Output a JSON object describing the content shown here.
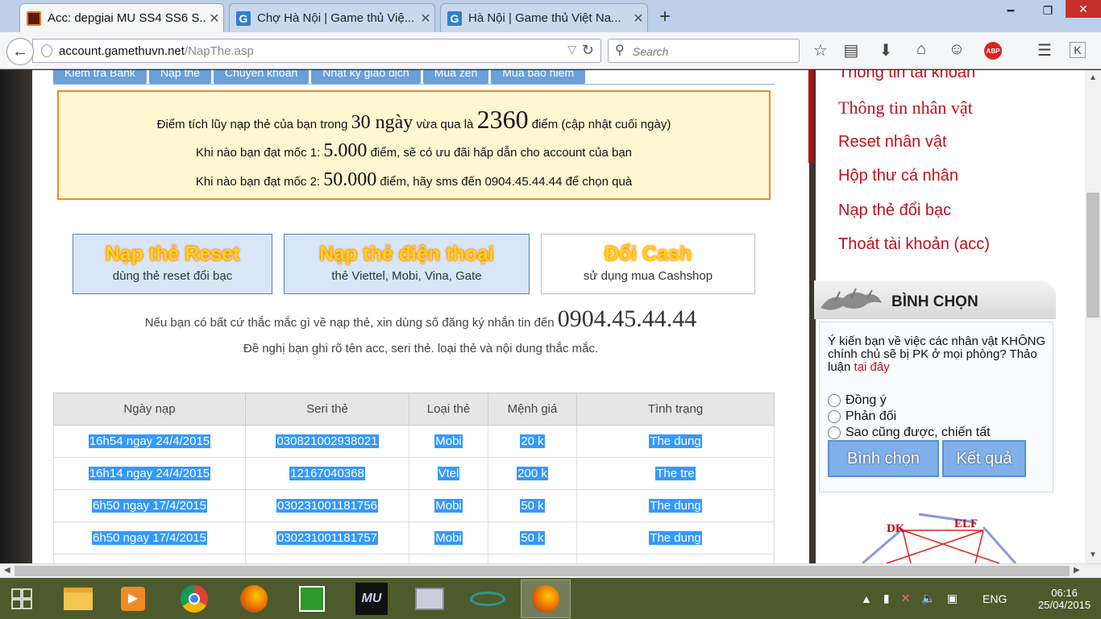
{
  "tabs": [
    {
      "title": "Acc: depgiai MU SS4 SS6 S...",
      "icon": "mu-game-icon",
      "active": true
    },
    {
      "title": "Chợ Hà Nội | Game thủ Việ...",
      "icon": "g-site-icon",
      "active": false
    },
    {
      "title": "Hà Nội | Game thủ Việt Na...",
      "icon": "g-site-icon",
      "active": false
    }
  ],
  "newtab": "+",
  "nav": {
    "url_domain": "account.gamethuvn.net",
    "url_path": "/NapThe.asp",
    "search_placeholder": "Search",
    "abp": "ABP"
  },
  "subtabs": [
    "Kiểm tra Bank",
    "Nạp thẻ",
    "Chuyển khoản",
    "Nhật ký giao dịch",
    "Mua zen",
    "Mua bảo hiểm"
  ],
  "notice": {
    "l1a": "Điểm tích lũy nạp thẻ của bạn trong ",
    "l1b": "30 ngày",
    "l1c": " vừa qua là ",
    "l1d": "2360",
    "l1e": " điểm (cập nhật cuối ngày)",
    "l2a": "Khi nào bạn đạt mốc 1: ",
    "l2b": "5.000",
    "l2c": " điểm, sẽ có ưu đãi hấp dẫn cho account của bạn",
    "l3a": "Khi nào bạn đạt mốc 2: ",
    "l3b": "50.000",
    "l3c": " điểm, hãy sms đến 0904.45.44.44 để chọn quà"
  },
  "options": [
    {
      "title": "Nạp thẻ Reset",
      "sub": "dùng thẻ reset đổi bạc"
    },
    {
      "title": "Nạp thẻ điện thoại",
      "sub": "thẻ Viettel, Mobi, Vina, Gate"
    },
    {
      "title": "Đổi Cash",
      "sub": "sử dụng mua Cashshop"
    }
  ],
  "help": {
    "line1": "Nếu bạn có bất cứ thắc mắc gì về nạp thẻ, xin dùng số đăng ký nhắn tin đến ",
    "phone": "0904.45.44.44",
    "line2": "Đề nghị bạn ghi rõ tên acc, seri thẻ. loại thẻ và nội dung thắc mắc."
  },
  "table": {
    "headers": [
      "Ngày nạp",
      "Seri thẻ",
      "Loại thẻ",
      "Mệnh giá",
      "Tình trạng"
    ],
    "rows": [
      [
        "16h54 ngay 24/4/2015",
        "030821002938021",
        "Mobi",
        "20 k",
        "The dung"
      ],
      [
        "16h14 ngay 24/4/2015",
        "12167040368",
        "Vtel",
        "200 k",
        "The tre"
      ],
      [
        "6h50 ngay 17/4/2015",
        "030231001181756",
        "Mobi",
        "50 k",
        "The dung"
      ],
      [
        "6h50 ngay 17/4/2015",
        "030231001181757",
        "Mobi",
        "50 k",
        "The dung"
      ]
    ]
  },
  "sidebar": {
    "menu": [
      "Thông tin tài khoản",
      "Thông tin nhân vật",
      "Reset nhân vật",
      "Hộp thư cá nhân",
      "Nạp thẻ đổi bạc",
      "Thoát tài khoản (acc)"
    ],
    "vote_title": "BÌNH CHỌN",
    "vote_question": "Ý kiến bạn về việc các nhân vật KHÔNG chính chủ sẽ bị PK ở mọi phòng? Thảo luận ",
    "vote_link": "tại đây",
    "vote_options": [
      "Đồng ý",
      "Phản đối",
      "Sao cũng được, chiến tất"
    ],
    "vote_button": "Bình chọn",
    "result_button": "Kết quả",
    "diagram_labels": [
      "DK",
      "ELF"
    ]
  },
  "taskbar": {
    "lang": "ENG",
    "time": "06:16",
    "date": "25/04/2015"
  }
}
